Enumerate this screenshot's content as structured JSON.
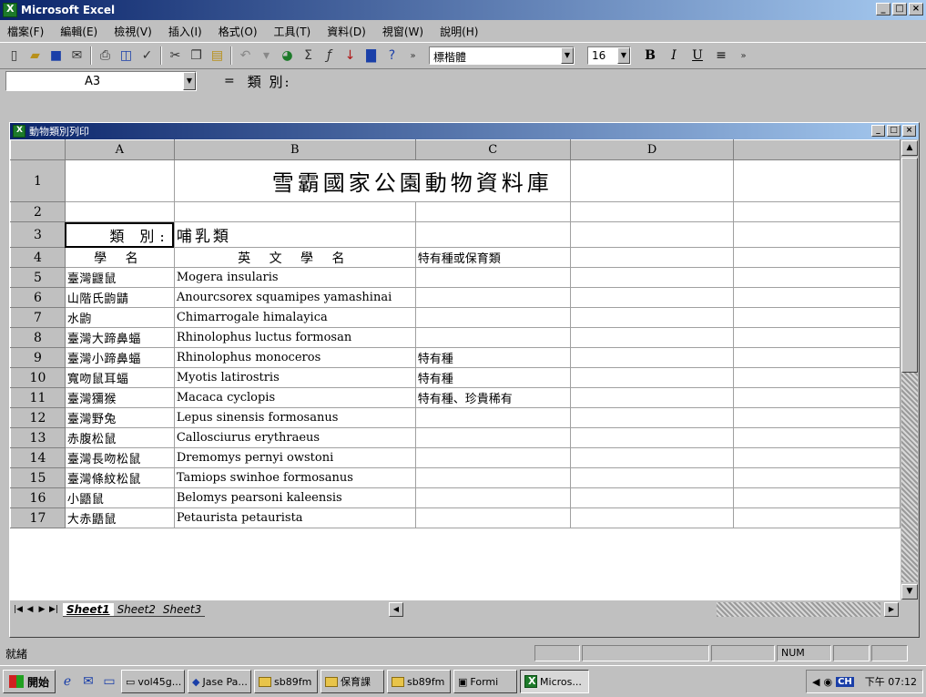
{
  "app": {
    "title": "Microsoft Excel"
  },
  "window_buttons": [
    "_",
    "□",
    "×"
  ],
  "menu": [
    "檔案(F)",
    "編輯(E)",
    "檢視(V)",
    "插入(I)",
    "格式(O)",
    "工具(T)",
    "資料(D)",
    "視窗(W)",
    "說明(H)"
  ],
  "toolbar": {
    "font": "標楷體",
    "size": "16",
    "bold": "B",
    "italic": "I",
    "underline": "U"
  },
  "formula_bar": {
    "cell_ref": "A3",
    "equals": "=",
    "formula": "類 別:"
  },
  "workbook": {
    "title": "動物類別列印"
  },
  "columns": [
    "A",
    "B",
    "C",
    "D"
  ],
  "rows": [
    {
      "num": "1",
      "a": "",
      "b": "雪霸國家公園動物資料庫",
      "c": "",
      "d": ""
    },
    {
      "num": "2",
      "a": "",
      "b": "",
      "c": "",
      "d": ""
    },
    {
      "num": "3",
      "a": "類 別:",
      "b": "哺乳類",
      "c": "",
      "d": ""
    },
    {
      "num": "4",
      "a": "學 名",
      "b": "英 文 學 名",
      "c": "特有種或保育類",
      "d": ""
    },
    {
      "num": "5",
      "a": "臺灣鼴鼠",
      "b": "Mogera insularis",
      "c": "",
      "d": ""
    },
    {
      "num": "6",
      "a": "山階氏鼩鼱",
      "b": "Anourcsorex squamipes yamashinai",
      "c": "",
      "d": ""
    },
    {
      "num": "7",
      "a": "水鼩",
      "b": "Chimarrogale himalayica",
      "c": "",
      "d": ""
    },
    {
      "num": "8",
      "a": "臺灣大蹄鼻蝠",
      "b": "Rhinolophus luctus formosan",
      "c": "",
      "d": ""
    },
    {
      "num": "9",
      "a": "臺灣小蹄鼻蝠",
      "b": "Rhinolophus monoceros",
      "c": "特有種",
      "d": ""
    },
    {
      "num": "10",
      "a": "寬吻鼠耳蝠",
      "b": "Myotis latirostris",
      "c": "特有種",
      "d": ""
    },
    {
      "num": "11",
      "a": "臺灣獼猴",
      "b": "Macaca cyclopis",
      "c": "特有種、珍貴稀有",
      "d": ""
    },
    {
      "num": "12",
      "a": "臺灣野兔",
      "b": "Lepus sinensis formosanus",
      "c": "",
      "d": ""
    },
    {
      "num": "13",
      "a": "赤腹松鼠",
      "b": "Callosciurus erythraeus",
      "c": "",
      "d": ""
    },
    {
      "num": "14",
      "a": "臺灣長吻松鼠",
      "b": "Dremomys pernyi owstoni",
      "c": "",
      "d": ""
    },
    {
      "num": "15",
      "a": "臺灣條紋松鼠",
      "b": "Tamiops swinhoe formosanus",
      "c": "",
      "d": ""
    },
    {
      "num": "16",
      "a": "小鼯鼠",
      "b": "Belomys pearsoni kaleensis",
      "c": "",
      "d": ""
    },
    {
      "num": "17",
      "a": "大赤鼯鼠",
      "b": "Petaurista petaurista",
      "c": "",
      "d": ""
    }
  ],
  "sheets": [
    "Sheet1",
    "Sheet2",
    "Sheet3"
  ],
  "status": {
    "left": "就緒",
    "num": "NUM"
  },
  "taskbar": {
    "start": "開始",
    "tasks": [
      "vol45g...",
      "Jase Pa...",
      "sb89fm",
      "保育課",
      "sb89fm",
      "Formi",
      "Micros..."
    ],
    "ime": "CH",
    "clock": "下午 07:12"
  }
}
